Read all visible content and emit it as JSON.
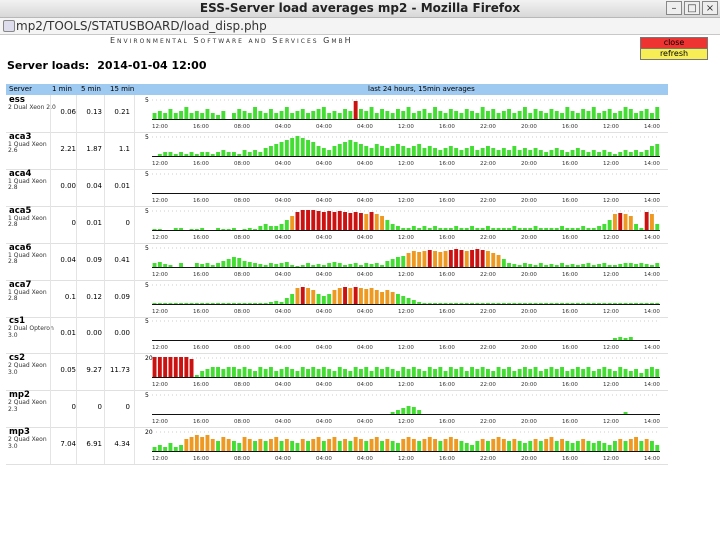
{
  "window": {
    "title": "ESS-Server load averages mp2 - Mozilla Firefox",
    "url": "mp2/TOOLS/STATUSBOARD/load_disp.php"
  },
  "page": {
    "org": "Environmental Software and Services GmbH",
    "title_label": "Server loads:",
    "title_date": "2014-01-04 12:00",
    "close_label": "close",
    "refresh_label": "refresh"
  },
  "colors": {
    "green": "#44dd33",
    "orange": "#ee9922",
    "red": "#cc1111",
    "header": "#9ec9f0"
  },
  "table": {
    "headers": {
      "server": "Server",
      "min1": "1 min",
      "min5": "5 min",
      "min15": "15 min",
      "chart": "last 24 hours, 15min averages"
    }
  },
  "time_ticks": [
    "12:00",
    "16:00",
    "08:00",
    "04:00",
    "04:00",
    "04:00",
    "12:00",
    "16:00",
    "22:00",
    "20:00",
    "16:00",
    "12:00",
    "14:00"
  ],
  "servers": [
    {
      "name": "ess",
      "desc": "2 Dual Xeon 2.0",
      "l1": "0.06",
      "l5": "0.13",
      "l15": "0.21",
      "ymax": "5",
      "bars": [
        0,
        1,
        1,
        1,
        1,
        1,
        1,
        1,
        1,
        1,
        1,
        1,
        1,
        1,
        0,
        1,
        1,
        1,
        1,
        1,
        1,
        1,
        1,
        1,
        1,
        1,
        1,
        1,
        1,
        1,
        1,
        1,
        1,
        1,
        1,
        1,
        1,
        1,
        2,
        1,
        1,
        1,
        1,
        1,
        1,
        1,
        1,
        1,
        1,
        1,
        1,
        1,
        1,
        1,
        1,
        1,
        1,
        1,
        1,
        1,
        1,
        1,
        1,
        1,
        1,
        1,
        1,
        1,
        1,
        1,
        1,
        1,
        1,
        1,
        1,
        1,
        1,
        1,
        1,
        1,
        1,
        1,
        1,
        1,
        1,
        1,
        1,
        1,
        1,
        1,
        1,
        1,
        1,
        1,
        1,
        1
      ],
      "levels": [
        0.3,
        0.4,
        0.3,
        0.5,
        0.3,
        0.4,
        0.6,
        0.3,
        0.4,
        0.3,
        0.5,
        0.3,
        0.2,
        0.4,
        0,
        0.3,
        0.5,
        0.4,
        0.3,
        0.6,
        0.4,
        0.3,
        0.5,
        0.3,
        0.4,
        0.6,
        0.3,
        0.4,
        0.5,
        0.3,
        0.4,
        0.5,
        0.6,
        0.3,
        0.4,
        0.3,
        0.5,
        0.4,
        0.9,
        0.5,
        0.4,
        0.6,
        0.3,
        0.5,
        0.4,
        0.3,
        0.5,
        0.4,
        0.6,
        0.3,
        0.4,
        0.5,
        0.3,
        0.6,
        0.4,
        0.3,
        0.5,
        0.4,
        0.3,
        0.5,
        0.4,
        0.3,
        0.6,
        0.4,
        0.5,
        0.3,
        0.4,
        0.5,
        0.3,
        0.4,
        0.6,
        0.3,
        0.5,
        0.4,
        0.3,
        0.5,
        0.4,
        0.3,
        0.6,
        0.4,
        0.3,
        0.5,
        0.4,
        0.6,
        0.3,
        0.4,
        0.5,
        0.3,
        0.4,
        0.6,
        0.5,
        0.3,
        0.4,
        0.5,
        0.3,
        0.6
      ]
    },
    {
      "name": "aca3",
      "desc": "1 Quad Xeon 2.6",
      "l1": "2.21",
      "l5": "1.87",
      "l15": "1.1",
      "ymax": "5",
      "levels": [
        0,
        0.1,
        0.2,
        0.2,
        0.1,
        0.2,
        0.1,
        0.2,
        0.1,
        0.2,
        0.2,
        0.1,
        0.2,
        0.3,
        0.2,
        0.2,
        0.1,
        0.3,
        0.2,
        0.3,
        0.2,
        0.4,
        0.5,
        0.6,
        0.7,
        0.8,
        0.9,
        1.0,
        0.9,
        0.8,
        0.7,
        0.5,
        0.4,
        0.3,
        0.5,
        0.6,
        0.7,
        0.8,
        0.7,
        0.6,
        0.5,
        0.4,
        0.6,
        0.5,
        0.4,
        0.5,
        0.6,
        0.5,
        0.4,
        0.5,
        0.6,
        0.4,
        0.5,
        0.4,
        0.3,
        0.4,
        0.5,
        0.4,
        0.3,
        0.4,
        0.5,
        0.3,
        0.4,
        0.5,
        0.4,
        0.3,
        0.4,
        0.3,
        0.5,
        0.3,
        0.4,
        0.3,
        0.4,
        0.3,
        0.2,
        0.3,
        0.4,
        0.3,
        0.2,
        0.3,
        0.4,
        0.3,
        0.2,
        0.3,
        0.2,
        0.3,
        0.2,
        0.1,
        0.2,
        0.3,
        0.2,
        0.3,
        0.2,
        0.3,
        0.5,
        0.6
      ]
    },
    {
      "name": "aca4",
      "desc": "1 Quad Xeon 2.8",
      "l1": "0.00",
      "l5": "0.04",
      "l15": "0.01",
      "ymax": "5",
      "levels": []
    },
    {
      "name": "aca5",
      "desc": "1 Quad Xeon 2.8",
      "l1": "0",
      "l5": "0.01",
      "l15": "0",
      "ymax": "5",
      "levels": [
        0.05,
        0.05,
        0,
        0,
        0.1,
        0.1,
        0,
        0.05,
        0.05,
        0.1,
        0,
        0,
        0.1,
        0.05,
        0.05,
        0.1,
        0,
        0.05,
        0.1,
        0.05,
        0.2,
        0.3,
        0.2,
        0.2,
        0.3,
        0.5,
        0.7,
        0.9,
        1.0,
        1.0,
        1.0,
        0.95,
        0.9,
        0.95,
        0.9,
        0.95,
        0.9,
        0.85,
        0.9,
        0.85,
        0.8,
        0.9,
        0.8,
        0.7,
        0.5,
        0.3,
        0.2,
        0.1,
        0.1,
        0.2,
        0.1,
        0.2,
        0.1,
        0.2,
        0.1,
        0.1,
        0.1,
        0.2,
        0.1,
        0.1,
        0.2,
        0.1,
        0.1,
        0.2,
        0.1,
        0.1,
        0.1,
        0.1,
        0.2,
        0.1,
        0.1,
        0.1,
        0.2,
        0.1,
        0.1,
        0.1,
        0.1,
        0.2,
        0.1,
        0.1,
        0.1,
        0.2,
        0.1,
        0.1,
        0.2,
        0.3,
        0.5,
        0.8,
        0.85,
        0.8,
        0.7,
        0.3,
        0.1,
        0.9,
        0.8,
        0.3
      ]
    },
    {
      "name": "aca6",
      "desc": "1 Quad Xeon 2.8",
      "l1": "0.04",
      "l5": "0.09",
      "l15": "0.41",
      "ymax": "5",
      "levels": [
        0.2,
        0.25,
        0.15,
        0.1,
        0,
        0.2,
        0,
        0,
        0.2,
        0.15,
        0.2,
        0.1,
        0.2,
        0.3,
        0.4,
        0.5,
        0.45,
        0.3,
        0.25,
        0.2,
        0.15,
        0.1,
        0.2,
        0.15,
        0.2,
        0.25,
        0.1,
        0.05,
        0.1,
        0.2,
        0.1,
        0.15,
        0.1,
        0.2,
        0.25,
        0.2,
        0.1,
        0.15,
        0.2,
        0.1,
        0.2,
        0.15,
        0.2,
        0.1,
        0.3,
        0.4,
        0.5,
        0.55,
        0.7,
        0.8,
        0.75,
        0.8,
        0.85,
        0.8,
        0.75,
        0.8,
        0.85,
        0.9,
        0.85,
        0.8,
        0.85,
        0.9,
        0.85,
        0.8,
        0.7,
        0.6,
        0.4,
        0.2,
        0.15,
        0.1,
        0.2,
        0.15,
        0.1,
        0.2,
        0.1,
        0.15,
        0.1,
        0.2,
        0.1,
        0.15,
        0.1,
        0.15,
        0.2,
        0.1,
        0.15,
        0.2,
        0.1,
        0.1,
        0.15,
        0.2,
        0.2,
        0.15,
        0.2,
        0.15,
        0.1,
        0.2
      ]
    },
    {
      "name": "aca7",
      "desc": "1 Quad Xeon 2.8",
      "l1": "0.1",
      "l5": "0.12",
      "l15": "0.09",
      "ymax": "5",
      "levels": [
        0.05,
        0.05,
        0.05,
        0.05,
        0.05,
        0.05,
        0.05,
        0.05,
        0.05,
        0.05,
        0.05,
        0.05,
        0.05,
        0.05,
        0.05,
        0.05,
        0.05,
        0.05,
        0.05,
        0.05,
        0.05,
        0.05,
        0.1,
        0.15,
        0.1,
        0.3,
        0.5,
        0.8,
        0.85,
        0.8,
        0.7,
        0.5,
        0.4,
        0.5,
        0.7,
        0.8,
        0.85,
        0.8,
        0.85,
        0.8,
        0.75,
        0.8,
        0.7,
        0.6,
        0.7,
        0.6,
        0.5,
        0.4,
        0.3,
        0.2,
        0.1,
        0.05,
        0.05,
        0.05,
        0.05,
        0.05,
        0.05,
        0.05,
        0.05,
        0.05,
        0.05,
        0.05,
        0.05,
        0.05,
        0.05,
        0.05,
        0.05,
        0.05,
        0.05,
        0.05,
        0.05,
        0.05,
        0.05,
        0.05,
        0.05,
        0.05,
        0.05,
        0.05,
        0.05,
        0.05,
        0.05,
        0.05,
        0.05,
        0.05,
        0.05,
        0.05,
        0.05,
        0.05,
        0.05,
        0.05,
        0.05,
        0.05,
        0.05,
        0.05,
        0.05,
        0.05
      ]
    },
    {
      "name": "cs1",
      "desc": "2 Dual Opteron 3.0",
      "l1": "0.01",
      "l5": "0.00",
      "l15": "0.00",
      "ymax": "5",
      "levels": [
        0,
        0,
        0,
        0,
        0,
        0,
        0,
        0,
        0,
        0,
        0,
        0,
        0,
        0,
        0,
        0,
        0,
        0,
        0,
        0,
        0,
        0,
        0,
        0,
        0,
        0,
        0,
        0,
        0,
        0,
        0,
        0,
        0,
        0,
        0,
        0,
        0,
        0,
        0,
        0,
        0,
        0,
        0,
        0,
        0,
        0,
        0,
        0,
        0,
        0,
        0,
        0,
        0,
        0,
        0,
        0,
        0,
        0,
        0,
        0,
        0,
        0,
        0,
        0,
        0,
        0,
        0,
        0,
        0,
        0,
        0,
        0,
        0,
        0,
        0,
        0,
        0,
        0,
        0,
        0,
        0,
        0,
        0,
        0,
        0,
        0,
        0,
        0.1,
        0.15,
        0.1,
        0.15,
        0,
        0,
        0,
        0,
        0
      ]
    },
    {
      "name": "cs2",
      "desc": "2 Quad Xeon 3.0",
      "l1": "0.05",
      "l5": "9.27",
      "l15": "11.73",
      "ymax": "20",
      "levels": [
        1,
        1,
        1,
        1,
        1,
        1,
        1,
        0.9,
        0.1,
        0.3,
        0.4,
        0.5,
        0.5,
        0.4,
        0.5,
        0.5,
        0.4,
        0.5,
        0.4,
        0.3,
        0.5,
        0.4,
        0.5,
        0.3,
        0.4,
        0.5,
        0.4,
        0.3,
        0.5,
        0.4,
        0.5,
        0.4,
        0.5,
        0.4,
        0.3,
        0.5,
        0.4,
        0.3,
        0.5,
        0.4,
        0.5,
        0.3,
        0.5,
        0.4,
        0.5,
        0.4,
        0.3,
        0.5,
        0.4,
        0.5,
        0.4,
        0.3,
        0.5,
        0.4,
        0.5,
        0.3,
        0.5,
        0.4,
        0.5,
        0.3,
        0.5,
        0.4,
        0.5,
        0.4,
        0.3,
        0.5,
        0.4,
        0.5,
        0.3,
        0.4,
        0.5,
        0.4,
        0.5,
        0.3,
        0.4,
        0.5,
        0.4,
        0.5,
        0.3,
        0.4,
        0.5,
        0.4,
        0.5,
        0.3,
        0.4,
        0.5,
        0.4,
        0.3,
        0.5,
        0.4,
        0.3,
        0.4,
        0.2,
        0.4,
        0.5,
        0.4
      ]
    },
    {
      "name": "mp2",
      "desc": "2 Quad Xeon 2.3",
      "l1": "0",
      "l5": "0",
      "l15": "0",
      "ymax": "5",
      "levels": [
        0,
        0,
        0,
        0,
        0,
        0,
        0,
        0,
        0,
        0,
        0,
        0,
        0,
        0,
        0,
        0,
        0,
        0,
        0,
        0,
        0,
        0,
        0,
        0,
        0,
        0,
        0,
        0,
        0,
        0,
        0,
        0,
        0,
        0,
        0,
        0,
        0,
        0,
        0,
        0,
        0,
        0,
        0,
        0,
        0,
        0.1,
        0.2,
        0.3,
        0.4,
        0.35,
        0.2,
        0,
        0,
        0,
        0,
        0,
        0,
        0,
        0,
        0,
        0,
        0,
        0,
        0,
        0,
        0,
        0,
        0,
        0,
        0,
        0,
        0,
        0,
        0,
        0,
        0,
        0,
        0,
        0,
        0,
        0,
        0,
        0,
        0,
        0,
        0,
        0,
        0,
        0,
        0.1,
        0,
        0,
        0,
        0,
        0,
        0
      ]
    },
    {
      "name": "mp3",
      "desc": "2 Quad Xeon 3.0",
      "l1": "7.04",
      "l5": "6.91",
      "l15": "4.34",
      "ymax": "20",
      "levels": [
        0.2,
        0.3,
        0.2,
        0.4,
        0.2,
        0.3,
        0.6,
        0.7,
        0.8,
        0.7,
        0.8,
        0.6,
        0.5,
        0.7,
        0.6,
        0.5,
        0.4,
        0.7,
        0.6,
        0.5,
        0.6,
        0.5,
        0.6,
        0.7,
        0.5,
        0.6,
        0.5,
        0.4,
        0.6,
        0.5,
        0.6,
        0.7,
        0.5,
        0.6,
        0.7,
        0.5,
        0.6,
        0.5,
        0.7,
        0.6,
        0.5,
        0.6,
        0.7,
        0.5,
        0.6,
        0.5,
        0.4,
        0.6,
        0.7,
        0.6,
        0.5,
        0.6,
        0.7,
        0.6,
        0.5,
        0.6,
        0.7,
        0.6,
        0.5,
        0.4,
        0.3,
        0.5,
        0.6,
        0.5,
        0.6,
        0.7,
        0.6,
        0.5,
        0.6,
        0.5,
        0.4,
        0.5,
        0.6,
        0.5,
        0.6,
        0.7,
        0.5,
        0.6,
        0.5,
        0.4,
        0.5,
        0.6,
        0.5,
        0.4,
        0.5,
        0.4,
        0.3,
        0.5,
        0.6,
        0.5,
        0.6,
        0.7,
        0.5,
        0.6,
        0.5,
        0.3
      ]
    }
  ]
}
